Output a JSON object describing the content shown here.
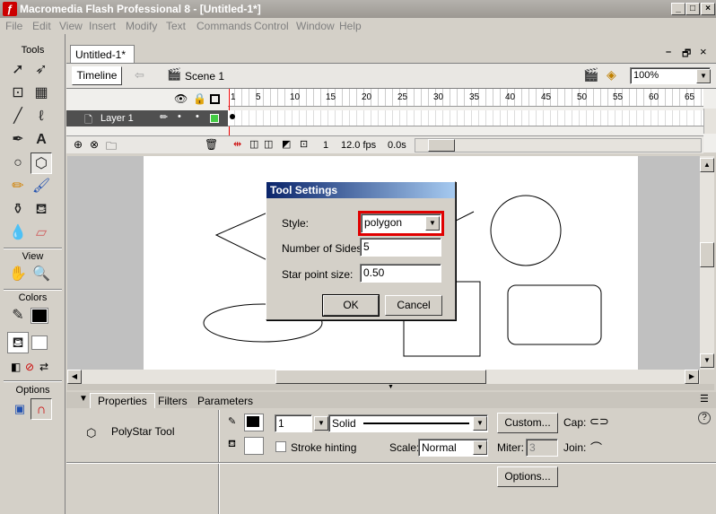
{
  "window": {
    "title": "Macromedia Flash Professional 8 - [Untitled-1*]",
    "min": "_",
    "max": "□",
    "close": "×"
  },
  "menu": [
    "File",
    "Edit",
    "View",
    "Insert",
    "Modify",
    "Text",
    "Commands",
    "Control",
    "Window",
    "Help"
  ],
  "tools": {
    "title": "Tools",
    "view_label": "View",
    "colors_label": "Colors",
    "options_label": "Options"
  },
  "document": {
    "tab": "Untitled-1*",
    "timeline_btn": "Timeline",
    "scene": "Scene 1",
    "zoom": "100%"
  },
  "timeline": {
    "layer": "Layer 1",
    "frame_numbers": [
      "1",
      "5",
      "10",
      "15",
      "20",
      "25",
      "30",
      "35",
      "40",
      "45",
      "50",
      "55",
      "60",
      "65"
    ],
    "current_frame": "1",
    "fps": "12.0 fps",
    "time": "0.0s"
  },
  "dialog": {
    "title": "Tool Settings",
    "style_label": "Style:",
    "style_value": "polygon",
    "sides_label": "Number of Sides:",
    "sides_value": "5",
    "star_label": "Star point size:",
    "star_value": "0.50",
    "ok": "OK",
    "cancel": "Cancel",
    "highlight_color": "#e00000"
  },
  "properties": {
    "tabs": [
      "Properties",
      "Filters",
      "Parameters"
    ],
    "tool_name": "PolyStar Tool",
    "stroke_height": "1",
    "stroke_style": "Solid",
    "custom_btn": "Custom...",
    "cap_label": "Cap:",
    "stroke_hinting": "Stroke hinting",
    "scale_label": "Scale:",
    "scale_value": "Normal",
    "miter_label": "Miter:",
    "miter_value": "3",
    "join_label": "Join:",
    "options_btn": "Options...",
    "help": "?"
  }
}
